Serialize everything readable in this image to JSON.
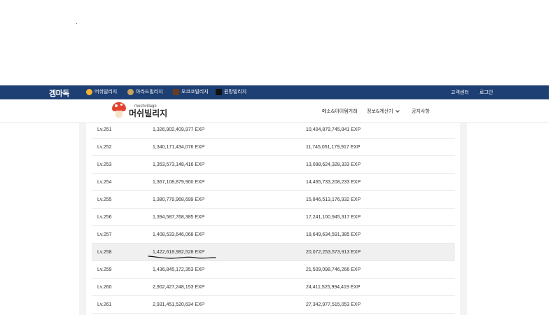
{
  "topbar": {
    "brand": "겜마독",
    "nav_items": [
      {
        "label": "머쉬빌리지",
        "icon": "mushroom-icon"
      },
      {
        "label": "아라드빌리지",
        "icon": "arad-icon"
      },
      {
        "label": "오코코빌리지",
        "icon": "okoko-icon"
      },
      {
        "label": "원망빌리지",
        "icon": "wonmang-icon"
      }
    ],
    "customer_center": "고객센터",
    "login": "로그인"
  },
  "header": {
    "logo_small": "mushvillage",
    "logo_big": "머쉬빌리지",
    "menu": {
      "trade": "메소&아이템거래",
      "info": "정보&계산기",
      "notice": "공지사항"
    }
  },
  "table": {
    "rows": [
      {
        "lv": "Lv.251",
        "exp": "1,326,902,409,977 EXP",
        "total": "10,404,879,745,841 EXP"
      },
      {
        "lv": "Lv.252",
        "exp": "1,340,171,434,076 EXP",
        "total": "11,745,051,179,917 EXP"
      },
      {
        "lv": "Lv.253",
        "exp": "1,353,573,148,416 EXP",
        "total": "13,098,624,328,333 EXP"
      },
      {
        "lv": "Lv.254",
        "exp": "1,367,108,879,900 EXP",
        "total": "14,465,733,208,233 EXP"
      },
      {
        "lv": "Lv.255",
        "exp": "1,380,779,968,699 EXP",
        "total": "15,846,513,176,932 EXP"
      },
      {
        "lv": "Lv.256",
        "exp": "1,394,587,768,385 EXP",
        "total": "17,241,100,945,317 EXP"
      },
      {
        "lv": "Lv.257",
        "exp": "1,408,533,646,068 EXP",
        "total": "18,649,634,591,385 EXP"
      },
      {
        "lv": "Lv.258",
        "exp": "1,422,618,982,528 EXP",
        "total": "20,072,253,573,913 EXP"
      },
      {
        "lv": "Lv.259",
        "exp": "1,436,845,172,353 EXP",
        "total": "21,509,098,746,266 EXP"
      },
      {
        "lv": "Lv.260",
        "exp": "2,902,427,248,153 EXP",
        "total": "24,411,525,994,419 EXP"
      },
      {
        "lv": "Lv.261",
        "exp": "2,931,451,520,634 EXP",
        "total": "27,342,977,515,053 EXP"
      }
    ],
    "highlighted_row": "Lv.258"
  },
  "colors": {
    "topbar": "#1e3f73",
    "highlight_row": "#f0f0f0",
    "annotation": "#111111"
  }
}
